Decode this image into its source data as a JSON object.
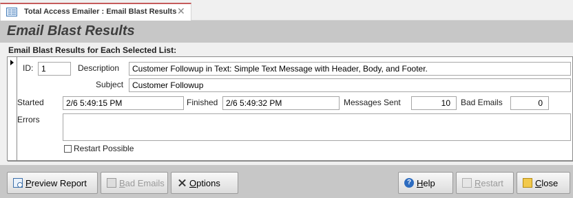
{
  "tab": {
    "title": "Total Access Emailer : Email Blast Results",
    "close_glyph": "✕",
    "icon": "form-icon"
  },
  "header": {
    "title": "Email Blast Results"
  },
  "section": {
    "label": "Email Blast Results for Each Selected List:"
  },
  "record": {
    "id_label": "ID:",
    "id_value": "1",
    "description_label": "Description",
    "description_value": "Customer Followup in Text: Simple Text Message with Header, Body, and Footer.",
    "subject_label": "Subject",
    "subject_value": "Customer Followup",
    "started_label": "Started",
    "started_value": "2/6  5:49:15 PM",
    "finished_label": "Finished",
    "finished_value": "2/6  5:49:32 PM",
    "messages_sent_label": "Messages Sent",
    "messages_sent_value": "10",
    "bad_emails_label": "Bad Emails",
    "bad_emails_value": "0",
    "errors_label": "Errors",
    "errors_value": "",
    "restart_possible_label": "Restart Possible",
    "restart_possible_checked": false
  },
  "buttons": {
    "preview_report": {
      "prefix": "",
      "accel": "P",
      "rest": "review Report",
      "icon": "report-icon",
      "enabled": true
    },
    "bad_emails": {
      "prefix": "",
      "accel": "B",
      "rest": "ad Emails",
      "icon": "bad-emails-icon",
      "enabled": false
    },
    "options": {
      "prefix": "",
      "accel": "O",
      "rest": "ptions",
      "icon": "tools-icon",
      "enabled": true
    },
    "help": {
      "prefix": "",
      "accel": "H",
      "rest": "elp",
      "icon": "help-icon",
      "enabled": true
    },
    "restart": {
      "prefix": "",
      "accel": "R",
      "rest": "estart",
      "icon": "restart-icon",
      "enabled": false
    },
    "close": {
      "prefix": "",
      "accel": "C",
      "rest": "lose",
      "icon": "folder-close-icon",
      "enabled": true
    }
  },
  "colors": {
    "header_bg": "#c7c7c7",
    "tab_accent": "#c55a5a",
    "help_icon": "#2d6cc0"
  }
}
